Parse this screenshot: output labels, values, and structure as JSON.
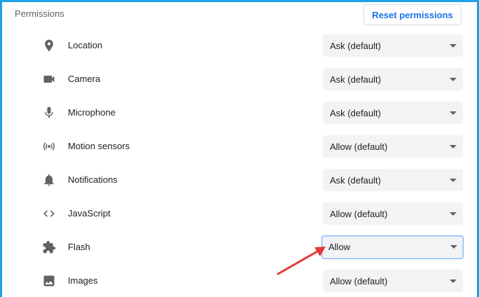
{
  "header": {
    "title": "Permissions",
    "reset_label": "Reset permissions"
  },
  "permissions": [
    {
      "label": "Location",
      "value": "Ask (default)",
      "icon": "location-pin-icon"
    },
    {
      "label": "Camera",
      "value": "Ask (default)",
      "icon": "camera-icon"
    },
    {
      "label": "Microphone",
      "value": "Ask (default)",
      "icon": "microphone-icon"
    },
    {
      "label": "Motion sensors",
      "value": "Allow (default)",
      "icon": "sensors-icon"
    },
    {
      "label": "Notifications",
      "value": "Ask (default)",
      "icon": "bell-icon"
    },
    {
      "label": "JavaScript",
      "value": "Allow (default)",
      "icon": "code-icon"
    },
    {
      "label": "Flash",
      "value": "Allow",
      "icon": "puzzle-icon"
    },
    {
      "label": "Images",
      "value": "Allow (default)",
      "icon": "image-icon"
    }
  ],
  "colors": {
    "frame_border": "#1ea1e6",
    "accent": "#1a73e8",
    "annotation_arrow": "#e53935"
  }
}
